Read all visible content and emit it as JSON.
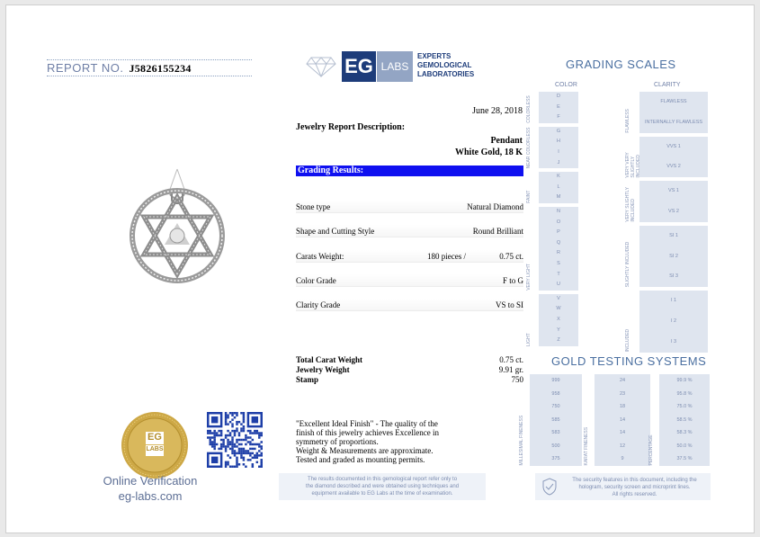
{
  "report": {
    "label": "REPORT NO.",
    "number": "J5826155234"
  },
  "logo": {
    "eg": "EG",
    "labs": "LABS",
    "line1": "EXPERTS",
    "line2": "GEMOLOGICAL",
    "line3": "LABORATORIES"
  },
  "date": "June 28, 2018",
  "description": {
    "title": "Jewelry Report Description:",
    "item": "Pendant",
    "metal": "White Gold, 18 K"
  },
  "grading_results": {
    "title": "Grading Results:",
    "rows": [
      {
        "label": "Stone type",
        "mid": "",
        "value": "Natural Diamond"
      },
      {
        "label": "Shape and Cutting Style",
        "mid": "",
        "value": "Round Brilliant"
      },
      {
        "label": "Carats Weight:",
        "mid": "180 pieces /",
        "value": "0.75 ct."
      },
      {
        "label": "Color Grade",
        "mid": "",
        "value": "F to G"
      },
      {
        "label": "Clarity Grade",
        "mid": "",
        "value": "VS to SI"
      }
    ]
  },
  "totals": [
    {
      "label": "Total Carat Weight",
      "value": "0.75 ct."
    },
    {
      "label": "Jewelry Weight",
      "value": "9.91 gr."
    },
    {
      "label": "Stamp",
      "value": "750"
    }
  ],
  "comment": {
    "line1": "\"Excellent Ideal Finish\" - The quality of the",
    "line2": "finish of this jewelry achieves Excellence in",
    "line3": "symmetry of proportions.",
    "line4": "Weight & Measurements are approximate.",
    "line5": "Tested and graded as mounting permits."
  },
  "fine_print_left": {
    "line1": "The results documented in this gemological report refer only to",
    "line2": "the diamond described and were obtained using techniques and",
    "line3": "equipment available to EG Labs at the time of examination."
  },
  "fine_print_right": {
    "line1": "The security features in this document, including the",
    "line2": "hologram, security screen and microprint lines.",
    "line3": "All rights reserved."
  },
  "verification": {
    "line1": "Online Verification",
    "line2": "eg-labs.com"
  },
  "seal": {
    "text": "EG",
    "sub": "LABS"
  },
  "grading_scales": {
    "title": "GRADING SCALES",
    "color_label": "COLOR",
    "clarity_label": "CLARITY",
    "colors": [
      "D",
      "E",
      "F",
      "G",
      "H",
      "I",
      "J",
      "K",
      "L",
      "M",
      "N",
      "O",
      "P",
      "Q",
      "R",
      "S",
      "T",
      "U",
      "V",
      "W",
      "X",
      "Y",
      "Z"
    ],
    "color_groups": [
      "COLORLESS",
      "NEAR COLORLESS",
      "FAINT",
      "VERY LIGHT",
      "LIGHT"
    ],
    "clarity": [
      "FLAWLESS",
      "INTERNALLY FLAWLESS",
      "VVS 1",
      "VVS 2",
      "VS 1",
      "VS 2",
      "SI 1",
      "SI 2",
      "SI 3",
      "I 1",
      "I 2",
      "I 3"
    ],
    "clarity_groups": [
      "FLAWLESS",
      "VERY VERY SLIGHTLY INCLUDED",
      "VERY SLIGHTLY INCLUDED",
      "SLIGHTLY INCLUDED",
      "INCLUDED"
    ]
  },
  "gold": {
    "title": "GOLD TESTING SYSTEMS",
    "rows": [
      {
        "a": "999",
        "b": "24",
        "c": "99.9 %"
      },
      {
        "a": "958",
        "b": "23",
        "c": "95.8 %"
      },
      {
        "a": "750",
        "b": "18",
        "c": "75.0 %"
      },
      {
        "a": "585",
        "b": "14",
        "c": "58.5 %"
      },
      {
        "a": "583",
        "b": "14",
        "c": "58.3 %"
      },
      {
        "a": "500",
        "b": "12",
        "c": "50.0 %"
      },
      {
        "a": "375",
        "b": "9",
        "c": "37.5 %"
      }
    ],
    "col_labels": [
      "MILLESIMAL FINENESS",
      "KARAT FINENESS",
      "PERCENTAGE"
    ]
  }
}
